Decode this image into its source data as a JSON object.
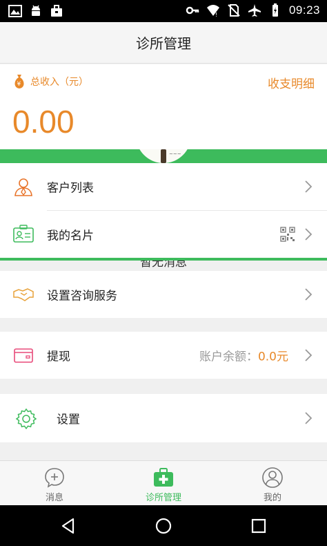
{
  "status_bar": {
    "time": "09:23",
    "left_icons": [
      "gallery-icon",
      "android-icon",
      "briefcase-icon"
    ],
    "right_icons": [
      "key-icon",
      "wifi-icon",
      "no-sim-icon",
      "airplane-icon",
      "battery-icon"
    ]
  },
  "header": {
    "title": "诊所管理"
  },
  "income": {
    "label": "总收入（元）",
    "link": "收支明细",
    "amount": "0.00",
    "accent_color": "#e8892a"
  },
  "overlay_text": "暂无消息",
  "menu": {
    "customers": {
      "label": "客户列表",
      "icon": "person-icon"
    },
    "card": {
      "label": "我的名片",
      "icon": "id-card-icon",
      "extra_icon": "qr-code-icon"
    },
    "consult": {
      "label": "设置咨询服务",
      "icon": "handshake-icon"
    },
    "withdraw": {
      "label": "提现",
      "icon": "wallet-icon",
      "balance_label": "账户余额：",
      "balance_value": "0.0元"
    },
    "settings": {
      "label": "设置",
      "icon": "gear-icon"
    }
  },
  "tabbar": {
    "tabs": [
      {
        "label": "消息",
        "icon": "chat-icon",
        "active": false
      },
      {
        "label": "诊所管理",
        "icon": "medical-kit-icon",
        "active": true
      },
      {
        "label": "我的",
        "icon": "user-icon",
        "active": false
      }
    ],
    "active_color": "#3dbb5c"
  },
  "nav_bar": {
    "buttons": [
      "back-icon",
      "home-icon",
      "recents-icon"
    ]
  }
}
